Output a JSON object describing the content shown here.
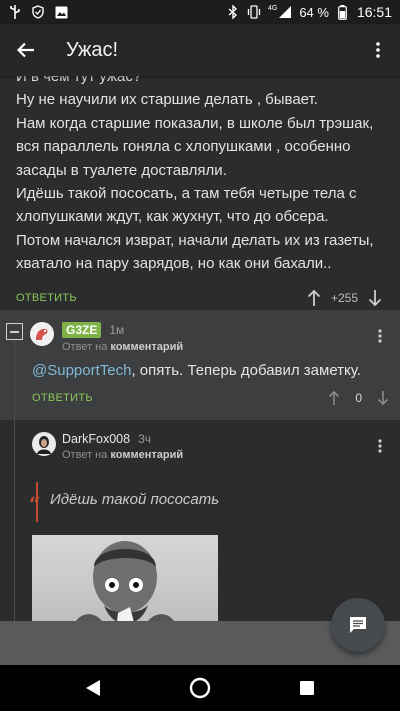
{
  "status": {
    "network": "4G",
    "battery": "64 %",
    "time": "16:51"
  },
  "appbar": {
    "title": "Ужас!"
  },
  "post": {
    "lines": [
      "И в чем тут ужас?",
      "Ну не научили их старшие делать , бывает.",
      "Нам когда старшие показали, в школе был трэшак,",
      "вся параллель гоняла с хлопушками , особенно",
      "засады в туалете доставляли.",
      "Идёшь такой пососать, а там тебя четыре тела с",
      "хлопушками ждут, как жухнут, что до обсера.",
      "Потом начался изврат, начали делать их из газеты,",
      "хватало на пару зарядов, но как они бахали.."
    ],
    "reply_label": "ОТВЕТИТЬ",
    "score": "+255"
  },
  "comment1": {
    "username": "G3ZE",
    "time": "1м",
    "sub_prefix": "Ответ на",
    "sub_link": "комментарий",
    "mention": "@SupportTech",
    "text": ", опять. Теперь добавил заметку.",
    "reply_label": "ОТВЕТИТЬ",
    "score": "0"
  },
  "comment2": {
    "username": "DarkFox008",
    "time": "3ч",
    "sub_prefix": "Ответ на",
    "sub_link": "комментарий",
    "quote_mark": "“",
    "quote": "Идёшь такой пососать"
  },
  "colors": {
    "accent": "#8ac858",
    "badge": "#7fb34a",
    "mention": "#7fb9d8",
    "quote": "#c94a2b"
  }
}
